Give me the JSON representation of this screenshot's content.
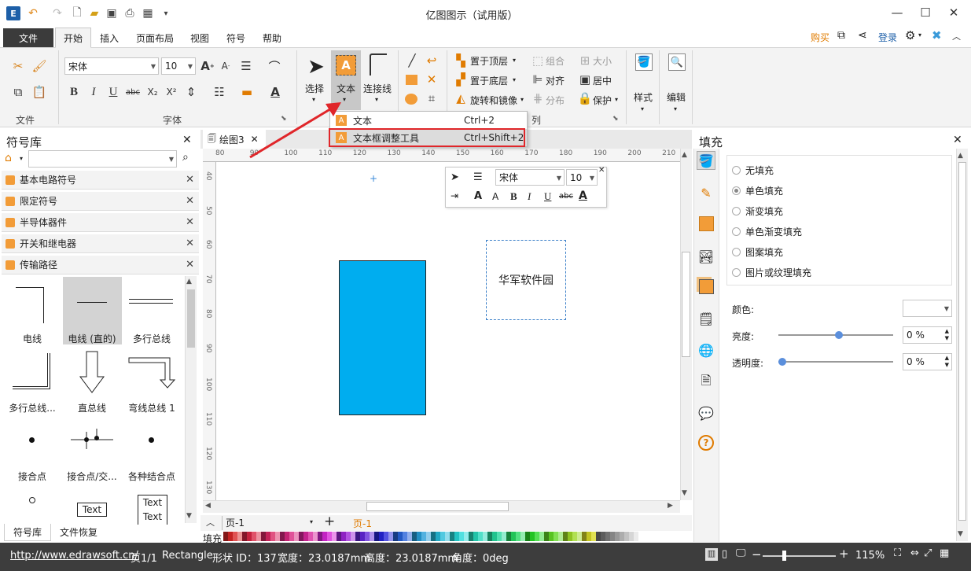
{
  "window": {
    "title": "亿图图示（试用版）",
    "minimize": "—",
    "maximize": "☐",
    "close": "✕"
  },
  "tabs": [
    "文件",
    "开始",
    "插入",
    "页面布局",
    "视图",
    "符号",
    "帮助"
  ],
  "account": {
    "buy": "购买",
    "login": "登录"
  },
  "ribbon": {
    "groups": {
      "file": "文件",
      "font": "字体",
      "arrange": "列"
    },
    "font_name": "宋体",
    "font_size": "10",
    "select": "选择",
    "text": "文本",
    "connector": "连接线",
    "bring_front": "置于顶层",
    "send_back": "置于底层",
    "rotate_mirror": "旋转和镜像",
    "group": "组合",
    "size": "大小",
    "align": "对齐",
    "center": "居中",
    "distribute": "分布",
    "protect": "保护",
    "style": "样式",
    "edit": "编辑"
  },
  "text_menu": {
    "items": [
      {
        "label": "文本",
        "shortcut": "Ctrl+2"
      },
      {
        "label": "文本框调整工具",
        "shortcut": "Ctrl+Shift+2"
      }
    ]
  },
  "library": {
    "title": "符号库",
    "categories": [
      "基本电路符号",
      "限定符号",
      "半导体器件",
      "开关和继电器",
      "传输路径"
    ],
    "symbols": [
      "电线",
      "电线 (直的)",
      "多行总线",
      "多行总线...",
      "直总线",
      "弯线总线 1",
      "接合点",
      "接合点/交...",
      "各种结合点"
    ],
    "text_sample_1": "Text",
    "text_sample_2": "Text",
    "text_sample_3": "Text",
    "bottom_tabs": [
      "符号库",
      "文件恢复"
    ]
  },
  "document": {
    "tab": "绘图3"
  },
  "ruler": {
    "h": [
      "80",
      "90",
      "100",
      "110",
      "120",
      "130",
      "140",
      "150",
      "160",
      "170",
      "180",
      "190",
      "200",
      "210"
    ],
    "v": [
      "40",
      "50",
      "60",
      "70",
      "80",
      "90",
      "100",
      "110",
      "120",
      "130"
    ]
  },
  "canvas": {
    "textbox": "华军软件园",
    "shape_color": "#00adef"
  },
  "float_toolbar": {
    "font": "宋体",
    "size": "10"
  },
  "pages": {
    "current": "页-1",
    "active_tab": "页-1"
  },
  "fill_label": "填充",
  "fill_panel": {
    "title": "填充",
    "options": [
      "无填充",
      "单色填充",
      "渐变填充",
      "单色渐变填充",
      "图案填充",
      "图片或纹理填充"
    ],
    "selected": 1,
    "color_label": "颜色:",
    "brightness_label": "亮度:",
    "brightness_value": "0 %",
    "transparency_label": "透明度:",
    "transparency_value": "0 %",
    "brightness_level": 0.5,
    "transparency_level": 0
  },
  "status": {
    "url": "http://www.edrawsoft.cn/",
    "page": "页1/1",
    "shape": "Rectangle",
    "shape_id": "形状 ID：137",
    "width": "宽度：23.0187mm",
    "height": "高度：23.0187mm",
    "angle": "角度：0deg",
    "zoom": "115%"
  }
}
